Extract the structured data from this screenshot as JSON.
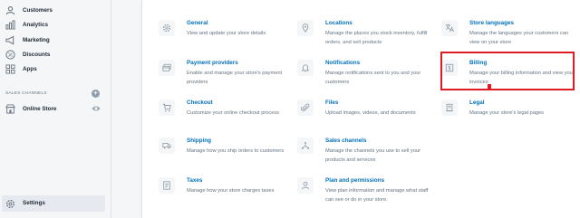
{
  "sidebar": {
    "items": [
      {
        "label": "Customers",
        "icon": "customers-icon"
      },
      {
        "label": "Analytics",
        "icon": "analytics-icon"
      },
      {
        "label": "Marketing",
        "icon": "marketing-icon"
      },
      {
        "label": "Discounts",
        "icon": "discounts-icon"
      },
      {
        "label": "Apps",
        "icon": "apps-icon"
      }
    ],
    "sales_channels_heading": "SALES CHANNELS",
    "add_channel_symbol": "+",
    "online_store": "Online Store",
    "settings": "Settings"
  },
  "settings": [
    {
      "title": "General",
      "description": "View and update your store details",
      "icon": "gear-icon"
    },
    {
      "title": "Locations",
      "description": "Manage the places you stock inventory, fulfill orders, and sell products",
      "icon": "location-pin-icon"
    },
    {
      "title": "Store languages",
      "description": "Manage the languages your customers can view on your store",
      "icon": "language-icon"
    },
    {
      "title": "Payment providers",
      "description": "Enable and manage your store's payment providers",
      "icon": "payment-icon"
    },
    {
      "title": "Notifications",
      "description": "Manage notifications sent to you and your customers",
      "icon": "bell-icon"
    },
    {
      "title": "Billing",
      "description": "Manage your billing information and view your invoices",
      "icon": "billing-icon"
    },
    {
      "title": "Checkout",
      "description": "Customize your online checkout process",
      "icon": "cart-icon"
    },
    {
      "title": "Files",
      "description": "Upload images, videos, and documents",
      "icon": "paperclip-icon"
    },
    {
      "title": "Legal",
      "description": "Manage your store's legal pages",
      "icon": "legal-icon"
    },
    {
      "title": "Shipping",
      "description": "Manage how you ship orders to customers",
      "icon": "truck-icon"
    },
    {
      "title": "Sales channels",
      "description": "Manage the channels you use to sell your products and services",
      "icon": "channels-icon"
    },
    {
      "title": "Taxes",
      "description": "Manage how your store charges taxes",
      "icon": "taxes-icon"
    },
    {
      "title": "Plan and permissions",
      "description": "View plan information and manage what staff can see or do in your store.",
      "icon": "user-icon"
    }
  ],
  "colors": {
    "link": "#006fbb",
    "highlight": "#e01b24",
    "sidebar_bg": "#f4f6f8"
  }
}
